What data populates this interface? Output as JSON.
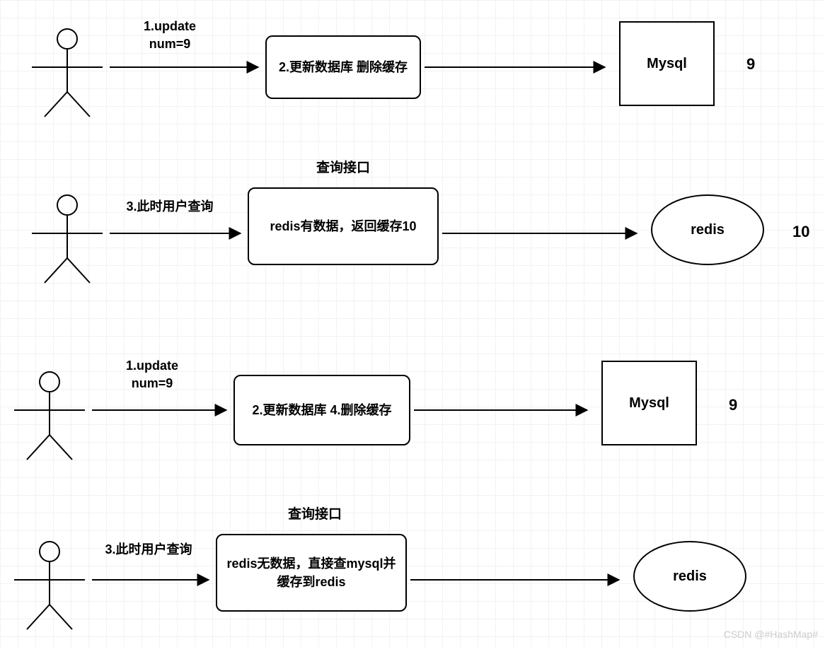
{
  "row1": {
    "arrowLabel": "1.update\nnum=9",
    "boxText": "2.更新数据库\n删除缓存",
    "dbLabel": "Mysql",
    "dbValue": "9"
  },
  "row2": {
    "header": "查询接口",
    "arrowLabel": "3.此时用户查询",
    "boxText": "redis有数据，返回缓存10",
    "cacheLabel": "redis",
    "cacheValue": "10"
  },
  "row3": {
    "arrowLabel": "1.update\nnum=9",
    "boxText": "2.更新数据库\n4.删除缓存",
    "dbLabel": "Mysql",
    "dbValue": "9"
  },
  "row4": {
    "header": "查询接口",
    "arrowLabel": "3.此时用户查询",
    "boxText": "redis无数据，直接查mysql并缓存到redis",
    "cacheLabel": "redis"
  },
  "watermark": "CSDN @#HashMap#"
}
